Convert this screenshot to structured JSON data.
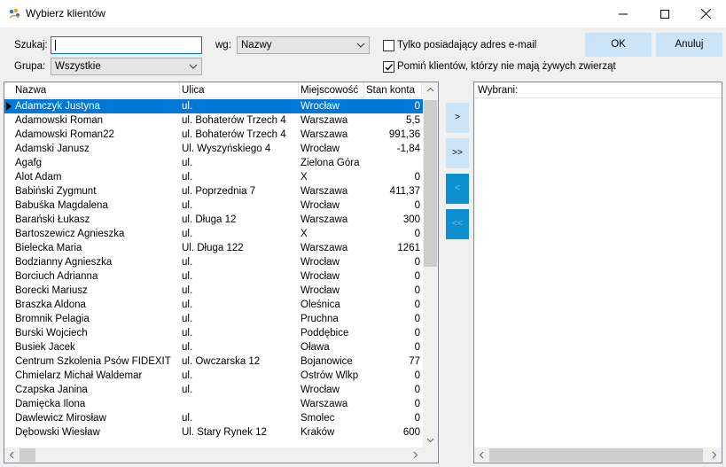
{
  "window": {
    "title": "Wybierz klientów",
    "minimize_label": "—",
    "maximize_label": "☐",
    "close_label": "✕"
  },
  "filters": {
    "search_label": "Szukaj:",
    "search_value": "",
    "by_label": "wg:",
    "by_value": "Nazwy",
    "group_label": "Grupa:",
    "group_value": "Wszystkie",
    "email_only_label": "Tylko posiadający adres e-mail",
    "email_only_checked": false,
    "skip_no_animals_label": "Pomiń klientów, którzy nie mają żywych zwierząt",
    "skip_no_animals_checked": true
  },
  "buttons": {
    "ok": "OK",
    "cancel": "Anuluj",
    "add_one": ">",
    "add_all": ">>",
    "remove_one": "<",
    "remove_all": "<<"
  },
  "table": {
    "columns": [
      "Nazwa",
      "Ulica",
      "Miejscowość",
      "Stan konta"
    ],
    "rows": [
      {
        "name": "Adamczyk  Justyna",
        "street": "ul.",
        "city": " Wrocław",
        "balance": "0",
        "selected": true
      },
      {
        "name": "Adamowski Roman",
        "street": "ul. Bohaterów Trzech 4",
        "city": "Warszawa",
        "balance": "5,5"
      },
      {
        "name": "Adamowski Roman22",
        "street": "ul. Bohaterów Trzech 4",
        "city": "Warszawa",
        "balance": "991,36"
      },
      {
        "name": "Adamski Janusz",
        "street": "Ul. Wyszyńskiego 4",
        "city": "Wrocław",
        "balance": "-1,84"
      },
      {
        "name": "Agafg",
        "street": "ul.",
        "city": "Zielona Góra",
        "balance": ""
      },
      {
        "name": "Alot  Adam",
        "street": "ul.",
        "city": " X",
        "balance": "0"
      },
      {
        "name": "Babiński Zygmunt",
        "street": "ul. Poprzednia 7",
        "city": "Warszawa",
        "balance": "411,37"
      },
      {
        "name": "Babuśka  Magdalena",
        "street": "ul.",
        "city": " Wrocław",
        "balance": "0"
      },
      {
        "name": "Barański Łukasz",
        "street": "ul. Długa 12",
        "city": "Warszawa",
        "balance": "300"
      },
      {
        "name": "Bartoszewicz  Agnieszka",
        "street": "ul.",
        "city": "X",
        "balance": "0"
      },
      {
        "name": "Bielecka Maria",
        "street": "Ul. Długa 122",
        "city": "Warszawa",
        "balance": "1261"
      },
      {
        "name": "Bodzianny  Agnieszka",
        "street": "ul.",
        "city": " Wrocław",
        "balance": "0"
      },
      {
        "name": "Borciuch  Adrianna",
        "street": "ul.",
        "city": " Wrocław",
        "balance": "0"
      },
      {
        "name": "Borecki  Mariusz",
        "street": "ul.",
        "city": " Wrocław",
        "balance": "0"
      },
      {
        "name": "Braszka  Aldona",
        "street": "ul.",
        "city": " Oleśnica",
        "balance": "0"
      },
      {
        "name": "Bromnik  Pelagia",
        "street": "ul.",
        "city": " Pruchna",
        "balance": "0"
      },
      {
        "name": "Burski  Wojciech",
        "street": "ul.",
        "city": " Poddębice",
        "balance": "0"
      },
      {
        "name": "Busiek  Jacek",
        "street": "ul.",
        "city": " Oława",
        "balance": "0"
      },
      {
        "name": "Centrum Szkolenia Psów FIDEXIT",
        "street": "ul. Owczarska 12",
        "city": "Bojanowice",
        "balance": "77"
      },
      {
        "name": "Chmielarz  Michał Waldemar",
        "street": "ul.",
        "city": " Ostrów Wlkp",
        "balance": "0"
      },
      {
        "name": "Czapska  Janina",
        "street": "ul.",
        "city": " Wrocław",
        "balance": "0"
      },
      {
        "name": "Damięcka Ilona",
        "street": "",
        "city": "Warszawa",
        "balance": "0"
      },
      {
        "name": "Dawlewicz  Mirosław",
        "street": "ul.",
        "city": " Smolec",
        "balance": "0"
      },
      {
        "name": "Dębowski Wiesław",
        "street": "Ul. Stary Rynek 12",
        "city": "Kraków",
        "balance": "600"
      }
    ]
  },
  "selected_panel": {
    "header": "Wybrani:"
  }
}
